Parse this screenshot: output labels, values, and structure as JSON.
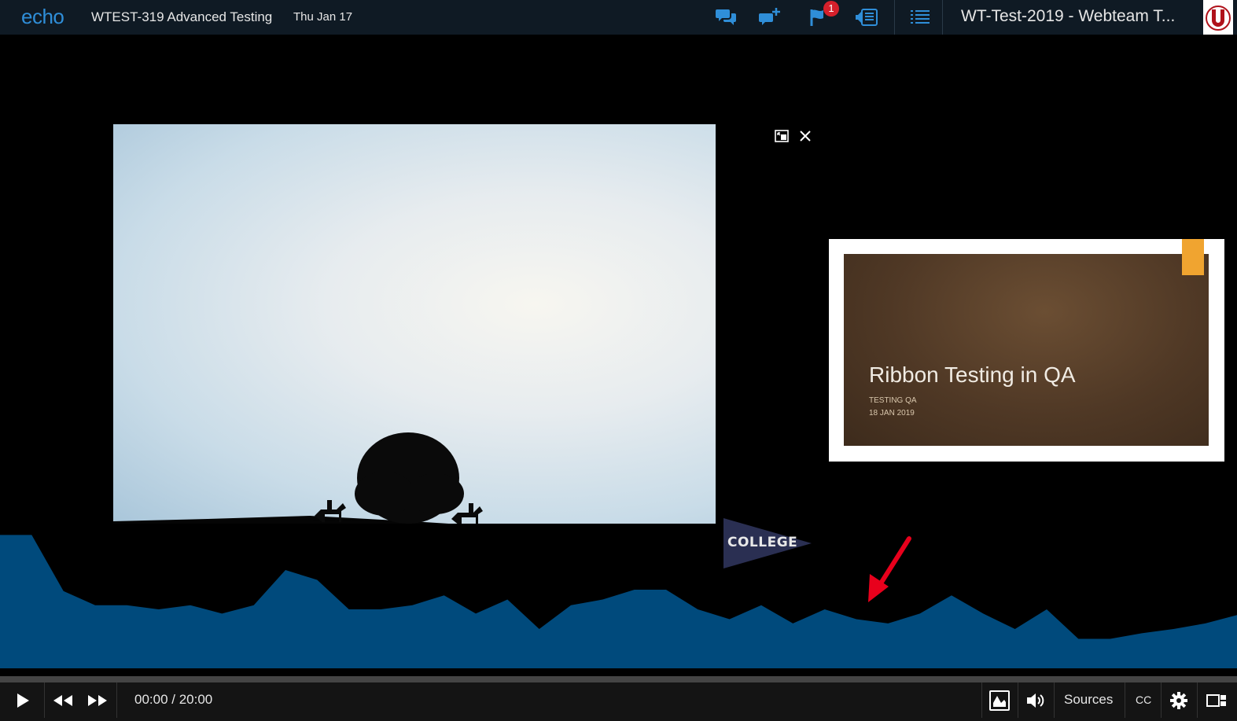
{
  "header": {
    "logo": "echo",
    "course_title": "WTEST-319 Advanced Testing",
    "date": "Thu Jan 17",
    "flag_badge": "1",
    "section_title": "WT-Test-2019 - Webteam T...",
    "icons": [
      "discussions-icon",
      "add-question-icon",
      "flag-icon",
      "transcript-icon",
      "outline-list-icon"
    ]
  },
  "slide": {
    "title": "Ribbon Testing in QA",
    "subtitle": "TESTING QA",
    "date": "18 JAN 2019"
  },
  "pennant": {
    "text": "COLLEGE"
  },
  "heatmap": {
    "color": "#004a7c",
    "values": [
      0.95,
      0.95,
      0.55,
      0.45,
      0.45,
      0.42,
      0.45,
      0.39,
      0.45,
      0.7,
      0.63,
      0.42,
      0.42,
      0.45,
      0.52,
      0.39,
      0.49,
      0.28,
      0.45,
      0.49,
      0.56,
      0.56,
      0.42,
      0.35,
      0.45,
      0.32,
      0.42,
      0.35,
      0.32,
      0.39,
      0.52,
      0.39,
      0.28,
      0.42,
      0.21,
      0.21,
      0.25,
      0.28,
      0.32,
      0.38
    ]
  },
  "player": {
    "time": "00:00 / 20:00",
    "progress": 0,
    "sources_label": "Sources",
    "cc_label": "CC"
  },
  "colors": {
    "accent": "#2f8ed8",
    "annotation": "#e8001c",
    "header_bg": "#0f1a24"
  }
}
